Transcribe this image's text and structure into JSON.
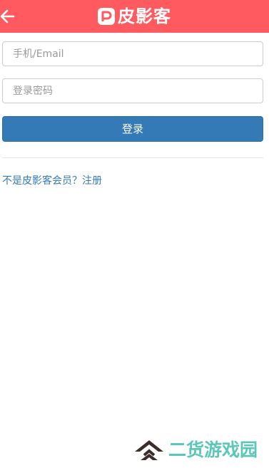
{
  "header": {
    "back_icon": "arrow-left-icon",
    "logo_text": "皮影客",
    "logo_icon": "p-logo-icon",
    "background": "#ff5a60"
  },
  "form": {
    "phone_placeholder": "手机/Email",
    "phone_value": "",
    "password_placeholder": "登录密码",
    "password_value": "",
    "login_label": "登录",
    "login_color": "#337ab7"
  },
  "register": {
    "prompt": "不是皮影客会员？",
    "link_label": "注册"
  },
  "watermark": {
    "icon": "double-chevron-up-icon",
    "text": "二货游戏园",
    "color": "#5cc7b9"
  }
}
